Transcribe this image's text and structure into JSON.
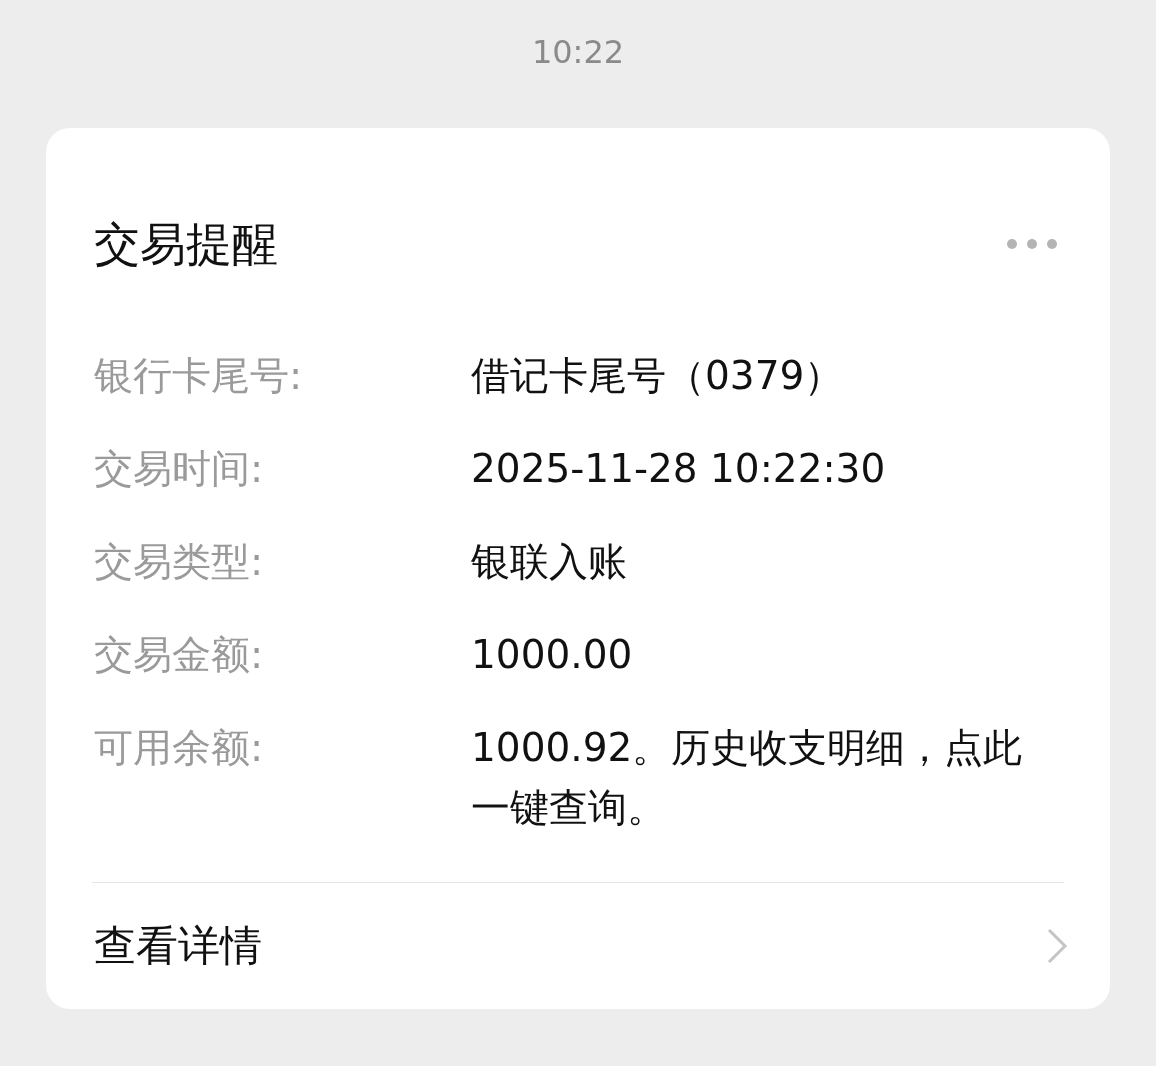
{
  "status_time": "10:22",
  "card": {
    "title": "交易提醒",
    "fields": [
      {
        "label": "银行卡尾号:",
        "value": "借记卡尾号（0379）"
      },
      {
        "label": "交易时间:",
        "value": "2025-11-28 10:22:30"
      },
      {
        "label": "交易类型:",
        "value": "银联入账"
      },
      {
        "label": "交易金额:",
        "value": "1000.00"
      },
      {
        "label": "可用余额:",
        "value": "1000.92。历史收支明细，点此一键查询。"
      }
    ],
    "footer_link": "查看详情"
  }
}
